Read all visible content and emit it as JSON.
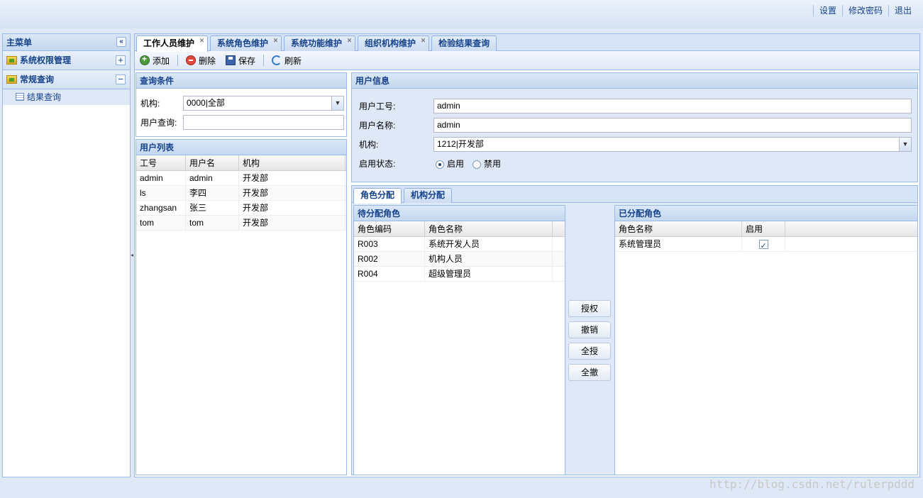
{
  "toplinks": [
    "设置",
    "修改密码",
    "退出"
  ],
  "west": {
    "title": "主菜单",
    "groups": [
      {
        "label": "系统权限管理",
        "toggle": "+"
      },
      {
        "label": "常规查询",
        "toggle": "−"
      }
    ],
    "leaf": "结果查询"
  },
  "tabs": [
    "工作人员维护",
    "系统角色维护",
    "系统功能维护",
    "组织机构维护",
    "检验结果查询"
  ],
  "toolbar": {
    "add": "添加",
    "delete": "删除",
    "save": "保存",
    "refresh": "刷新"
  },
  "query": {
    "title": "查询条件",
    "org_label": "机构:",
    "org_value": "0000|全部",
    "user_label": "用户查询:",
    "user_value": ""
  },
  "userlist": {
    "title": "用户列表",
    "columns": [
      "工号",
      "用户名",
      "机构"
    ],
    "rows": [
      [
        "admin",
        "admin",
        "开发部"
      ],
      [
        "ls",
        "李四",
        "开发部"
      ],
      [
        "zhangsan",
        "张三",
        "开发部"
      ],
      [
        "tom",
        "tom",
        "开发部"
      ]
    ]
  },
  "userinfo": {
    "title": "用户信息",
    "id_label": "用户工号:",
    "id_value": "admin",
    "name_label": "用户名称:",
    "name_value": "admin",
    "org_label": "机构:",
    "org_value": "1212|开发部",
    "status_label": "启用状态:",
    "status_on": "启用",
    "status_off": "禁用",
    "status_selected": "启用"
  },
  "subtabs": [
    "角色分配",
    "机构分配"
  ],
  "pending": {
    "title": "待分配角色",
    "columns": [
      "角色编码",
      "角色名称"
    ],
    "rows": [
      [
        "R003",
        "系统开发人员"
      ],
      [
        "R002",
        "机构人员"
      ],
      [
        "R004",
        "超级管理员"
      ]
    ]
  },
  "actions": [
    "授权",
    "撤销",
    "全授",
    "全撤"
  ],
  "assigned": {
    "title": "已分配角色",
    "columns": [
      "角色名称",
      "启用"
    ],
    "rows": [
      {
        "name": "系统管理员",
        "enabled": true
      }
    ]
  },
  "watermark": "http://blog.csdn.net/rulerpddd"
}
